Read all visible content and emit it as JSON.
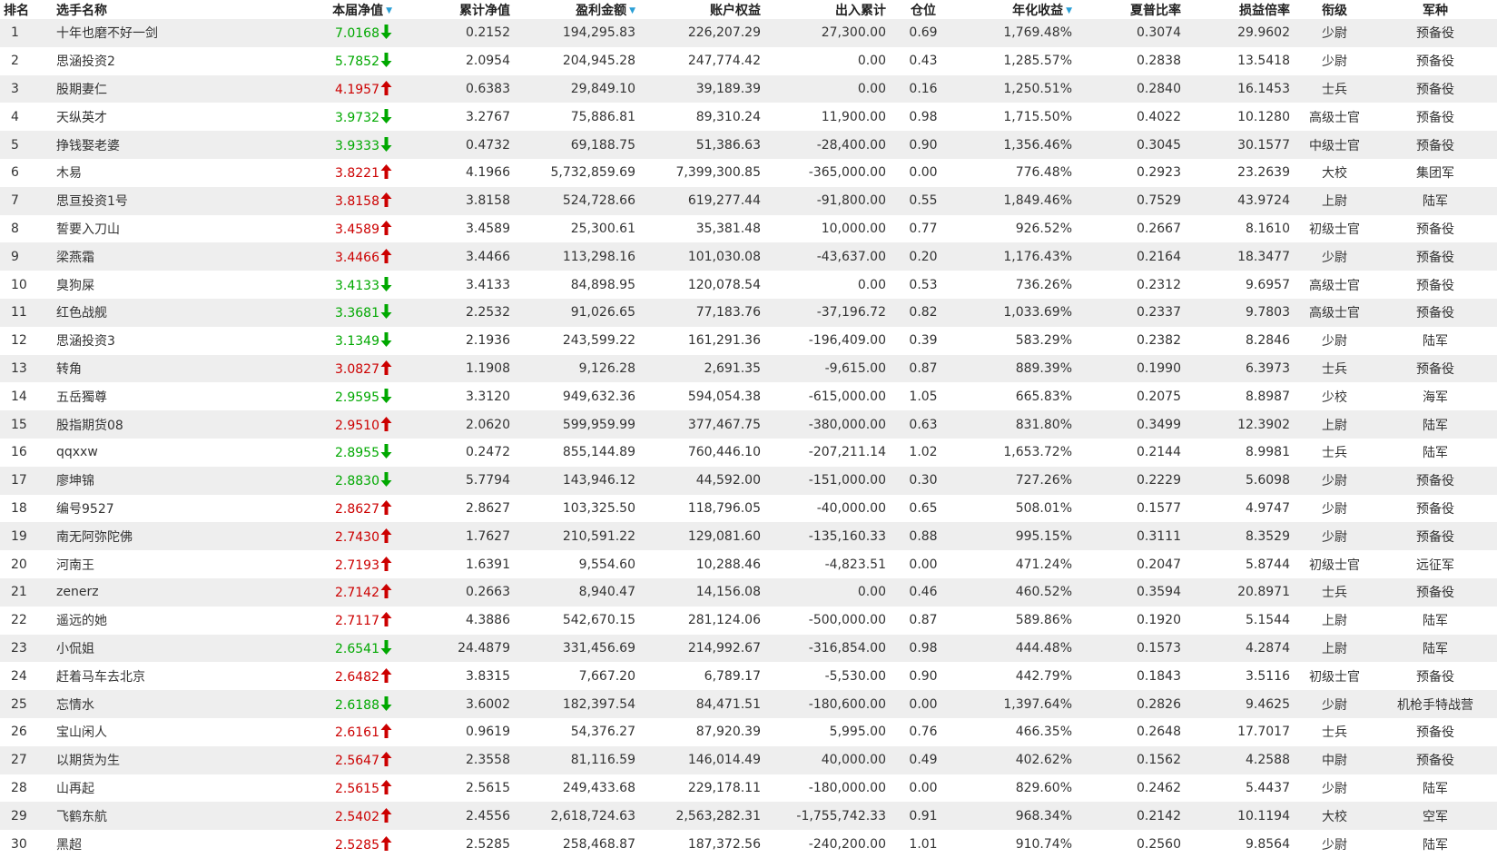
{
  "colors": {
    "up": "#cc0000",
    "down": "#00a800",
    "sort_icon": "#2a9fd6",
    "row_alt": "#eeeeee"
  },
  "columns": {
    "rank": "排名",
    "name": "选手名称",
    "nav": "本届净值",
    "cum_nav": "累计净值",
    "profit": "盈利金额",
    "equity": "账户权益",
    "flow": "出入累计",
    "position": "仓位",
    "annual": "年化收益",
    "sharpe": "夏普比率",
    "pl_ratio": "损益倍率",
    "rank_title": "衔级",
    "army": "军种"
  },
  "rows": [
    {
      "rank": "1",
      "name": "十年也磨不好一剑",
      "nav": "7.0168",
      "dir": "down",
      "cum_nav": "0.2152",
      "profit": "194,295.83",
      "equity": "226,207.29",
      "flow": "27,300.00",
      "position": "0.69",
      "annual": "1,769.48%",
      "sharpe": "0.3074",
      "pl_ratio": "29.9602",
      "rank_title": "少尉",
      "army": "预备役"
    },
    {
      "rank": "2",
      "name": "思涵投资2",
      "nav": "5.7852",
      "dir": "down",
      "cum_nav": "2.0954",
      "profit": "204,945.28",
      "equity": "247,774.42",
      "flow": "0.00",
      "position": "0.43",
      "annual": "1,285.57%",
      "sharpe": "0.2838",
      "pl_ratio": "13.5418",
      "rank_title": "少尉",
      "army": "预备役"
    },
    {
      "rank": "3",
      "name": "股期妻仁",
      "nav": "4.1957",
      "dir": "up",
      "cum_nav": "0.6383",
      "profit": "29,849.10",
      "equity": "39,189.39",
      "flow": "0.00",
      "position": "0.16",
      "annual": "1,250.51%",
      "sharpe": "0.2840",
      "pl_ratio": "16.1453",
      "rank_title": "士兵",
      "army": "预备役"
    },
    {
      "rank": "4",
      "name": "天纵英才",
      "nav": "3.9732",
      "dir": "down",
      "cum_nav": "3.2767",
      "profit": "75,886.81",
      "equity": "89,310.24",
      "flow": "11,900.00",
      "position": "0.98",
      "annual": "1,715.50%",
      "sharpe": "0.4022",
      "pl_ratio": "10.1280",
      "rank_title": "高级士官",
      "army": "预备役"
    },
    {
      "rank": "5",
      "name": "挣钱娶老婆",
      "nav": "3.9333",
      "dir": "down",
      "cum_nav": "0.4732",
      "profit": "69,188.75",
      "equity": "51,386.63",
      "flow": "-28,400.00",
      "position": "0.90",
      "annual": "1,356.46%",
      "sharpe": "0.3045",
      "pl_ratio": "30.1577",
      "rank_title": "中级士官",
      "army": "预备役"
    },
    {
      "rank": "6",
      "name": "木易",
      "nav": "3.8221",
      "dir": "up",
      "cum_nav": "4.1966",
      "profit": "5,732,859.69",
      "equity": "7,399,300.85",
      "flow": "-365,000.00",
      "position": "0.00",
      "annual": "776.48%",
      "sharpe": "0.2923",
      "pl_ratio": "23.2639",
      "rank_title": "大校",
      "army": "集团军"
    },
    {
      "rank": "7",
      "name": "思亘投资1号",
      "nav": "3.8158",
      "dir": "up",
      "cum_nav": "3.8158",
      "profit": "524,728.66",
      "equity": "619,277.44",
      "flow": "-91,800.00",
      "position": "0.55",
      "annual": "1,849.46%",
      "sharpe": "0.7529",
      "pl_ratio": "43.9724",
      "rank_title": "上尉",
      "army": "陆军"
    },
    {
      "rank": "8",
      "name": "誓要入刀山",
      "nav": "3.4589",
      "dir": "up",
      "cum_nav": "3.4589",
      "profit": "25,300.61",
      "equity": "35,381.48",
      "flow": "10,000.00",
      "position": "0.77",
      "annual": "926.52%",
      "sharpe": "0.2667",
      "pl_ratio": "8.1610",
      "rank_title": "初级士官",
      "army": "预备役"
    },
    {
      "rank": "9",
      "name": "梁燕霜",
      "nav": "3.4466",
      "dir": "up",
      "cum_nav": "3.4466",
      "profit": "113,298.16",
      "equity": "101,030.08",
      "flow": "-43,637.00",
      "position": "0.20",
      "annual": "1,176.43%",
      "sharpe": "0.2164",
      "pl_ratio": "18.3477",
      "rank_title": "少尉",
      "army": "预备役"
    },
    {
      "rank": "10",
      "name": "臭狗屎",
      "nav": "3.4133",
      "dir": "down",
      "cum_nav": "3.4133",
      "profit": "84,898.95",
      "equity": "120,078.54",
      "flow": "0.00",
      "position": "0.53",
      "annual": "736.26%",
      "sharpe": "0.2312",
      "pl_ratio": "9.6957",
      "rank_title": "高级士官",
      "army": "预备役"
    },
    {
      "rank": "11",
      "name": "红色战舰",
      "nav": "3.3681",
      "dir": "down",
      "cum_nav": "2.2532",
      "profit": "91,026.65",
      "equity": "77,183.76",
      "flow": "-37,196.72",
      "position": "0.82",
      "annual": "1,033.69%",
      "sharpe": "0.2337",
      "pl_ratio": "9.7803",
      "rank_title": "高级士官",
      "army": "预备役"
    },
    {
      "rank": "12",
      "name": "思涵投资3",
      "nav": "3.1349",
      "dir": "down",
      "cum_nav": "2.1936",
      "profit": "243,599.22",
      "equity": "161,291.36",
      "flow": "-196,409.00",
      "position": "0.39",
      "annual": "583.29%",
      "sharpe": "0.2382",
      "pl_ratio": "8.2846",
      "rank_title": "少尉",
      "army": "陆军"
    },
    {
      "rank": "13",
      "name": "转角",
      "nav": "3.0827",
      "dir": "up",
      "cum_nav": "1.1908",
      "profit": "9,126.28",
      "equity": "2,691.35",
      "flow": "-9,615.00",
      "position": "0.87",
      "annual": "889.39%",
      "sharpe": "0.1990",
      "pl_ratio": "6.3973",
      "rank_title": "士兵",
      "army": "预备役"
    },
    {
      "rank": "14",
      "name": "五岳獨尊",
      "nav": "2.9595",
      "dir": "down",
      "cum_nav": "3.3120",
      "profit": "949,632.36",
      "equity": "594,054.38",
      "flow": "-615,000.00",
      "position": "1.05",
      "annual": "665.83%",
      "sharpe": "0.2075",
      "pl_ratio": "8.8987",
      "rank_title": "少校",
      "army": "海军"
    },
    {
      "rank": "15",
      "name": "股指期货08",
      "nav": "2.9510",
      "dir": "up",
      "cum_nav": "2.0620",
      "profit": "599,959.99",
      "equity": "377,467.75",
      "flow": "-380,000.00",
      "position": "0.63",
      "annual": "831.80%",
      "sharpe": "0.3499",
      "pl_ratio": "12.3902",
      "rank_title": "上尉",
      "army": "陆军"
    },
    {
      "rank": "16",
      "name": "qqxxw",
      "nav": "2.8955",
      "dir": "down",
      "cum_nav": "0.2472",
      "profit": "855,144.89",
      "equity": "760,446.10",
      "flow": "-207,211.14",
      "position": "1.02",
      "annual": "1,653.72%",
      "sharpe": "0.2144",
      "pl_ratio": "8.9981",
      "rank_title": "士兵",
      "army": "陆军"
    },
    {
      "rank": "17",
      "name": "廖坤锦",
      "nav": "2.8830",
      "dir": "down",
      "cum_nav": "5.7794",
      "profit": "143,946.12",
      "equity": "44,592.00",
      "flow": "-151,000.00",
      "position": "0.30",
      "annual": "727.26%",
      "sharpe": "0.2229",
      "pl_ratio": "5.6098",
      "rank_title": "少尉",
      "army": "预备役"
    },
    {
      "rank": "18",
      "name": "编号9527",
      "nav": "2.8627",
      "dir": "up",
      "cum_nav": "2.8627",
      "profit": "103,325.50",
      "equity": "118,796.05",
      "flow": "-40,000.00",
      "position": "0.65",
      "annual": "508.01%",
      "sharpe": "0.1577",
      "pl_ratio": "4.9747",
      "rank_title": "少尉",
      "army": "预备役"
    },
    {
      "rank": "19",
      "name": "南无阿弥陀佛",
      "nav": "2.7430",
      "dir": "up",
      "cum_nav": "1.7627",
      "profit": "210,591.22",
      "equity": "129,081.60",
      "flow": "-135,160.33",
      "position": "0.88",
      "annual": "995.15%",
      "sharpe": "0.3111",
      "pl_ratio": "8.3529",
      "rank_title": "少尉",
      "army": "预备役"
    },
    {
      "rank": "20",
      "name": "河南王",
      "nav": "2.7193",
      "dir": "up",
      "cum_nav": "1.6391",
      "profit": "9,554.60",
      "equity": "10,288.46",
      "flow": "-4,823.51",
      "position": "0.00",
      "annual": "471.24%",
      "sharpe": "0.2047",
      "pl_ratio": "5.8744",
      "rank_title": "初级士官",
      "army": "远征军"
    },
    {
      "rank": "21",
      "name": "zenerz",
      "nav": "2.7142",
      "dir": "up",
      "cum_nav": "0.2663",
      "profit": "8,940.47",
      "equity": "14,156.08",
      "flow": "0.00",
      "position": "0.46",
      "annual": "460.52%",
      "sharpe": "0.3594",
      "pl_ratio": "20.8971",
      "rank_title": "士兵",
      "army": "预备役"
    },
    {
      "rank": "22",
      "name": "遥远的她",
      "nav": "2.7117",
      "dir": "up",
      "cum_nav": "4.3886",
      "profit": "542,670.15",
      "equity": "281,124.06",
      "flow": "-500,000.00",
      "position": "0.87",
      "annual": "589.86%",
      "sharpe": "0.1920",
      "pl_ratio": "5.1544",
      "rank_title": "上尉",
      "army": "陆军"
    },
    {
      "rank": "23",
      "name": "小侃姐",
      "nav": "2.6541",
      "dir": "down",
      "cum_nav": "24.4879",
      "profit": "331,456.69",
      "equity": "214,992.67",
      "flow": "-316,854.00",
      "position": "0.98",
      "annual": "444.48%",
      "sharpe": "0.1573",
      "pl_ratio": "4.2874",
      "rank_title": "上尉",
      "army": "陆军"
    },
    {
      "rank": "24",
      "name": "赶着马车去北京",
      "nav": "2.6482",
      "dir": "up",
      "cum_nav": "3.8315",
      "profit": "7,667.20",
      "equity": "6,789.17",
      "flow": "-5,530.00",
      "position": "0.90",
      "annual": "442.79%",
      "sharpe": "0.1843",
      "pl_ratio": "3.5116",
      "rank_title": "初级士官",
      "army": "预备役"
    },
    {
      "rank": "25",
      "name": "忘情水",
      "nav": "2.6188",
      "dir": "down",
      "cum_nav": "3.6002",
      "profit": "182,397.54",
      "equity": "84,471.51",
      "flow": "-180,600.00",
      "position": "0.00",
      "annual": "1,397.64%",
      "sharpe": "0.2826",
      "pl_ratio": "9.4625",
      "rank_title": "少尉",
      "army": "机枪手特战营"
    },
    {
      "rank": "26",
      "name": "宝山闲人",
      "nav": "2.6161",
      "dir": "up",
      "cum_nav": "0.9619",
      "profit": "54,376.27",
      "equity": "87,920.39",
      "flow": "5,995.00",
      "position": "0.76",
      "annual": "466.35%",
      "sharpe": "0.2648",
      "pl_ratio": "17.7017",
      "rank_title": "士兵",
      "army": "预备役"
    },
    {
      "rank": "27",
      "name": "以期货为生",
      "nav": "2.5647",
      "dir": "up",
      "cum_nav": "2.3558",
      "profit": "81,116.59",
      "equity": "146,014.49",
      "flow": "40,000.00",
      "position": "0.49",
      "annual": "402.62%",
      "sharpe": "0.1562",
      "pl_ratio": "4.2588",
      "rank_title": "中尉",
      "army": "预备役"
    },
    {
      "rank": "28",
      "name": "山再起",
      "nav": "2.5615",
      "dir": "up",
      "cum_nav": "2.5615",
      "profit": "249,433.68",
      "equity": "229,178.11",
      "flow": "-180,000.00",
      "position": "0.00",
      "annual": "829.60%",
      "sharpe": "0.2462",
      "pl_ratio": "5.4437",
      "rank_title": "少尉",
      "army": "陆军"
    },
    {
      "rank": "29",
      "name": "飞鹤东航",
      "nav": "2.5402",
      "dir": "up",
      "cum_nav": "2.4556",
      "profit": "2,618,724.63",
      "equity": "2,563,282.31",
      "flow": "-1,755,742.33",
      "position": "0.91",
      "annual": "968.34%",
      "sharpe": "0.2142",
      "pl_ratio": "10.1194",
      "rank_title": "大校",
      "army": "空军"
    },
    {
      "rank": "30",
      "name": "黑超",
      "nav": "2.5285",
      "dir": "up",
      "cum_nav": "2.5285",
      "profit": "258,468.87",
      "equity": "187,372.56",
      "flow": "-240,200.00",
      "position": "1.01",
      "annual": "910.74%",
      "sharpe": "0.2560",
      "pl_ratio": "9.8564",
      "rank_title": "少尉",
      "army": "陆军"
    }
  ]
}
